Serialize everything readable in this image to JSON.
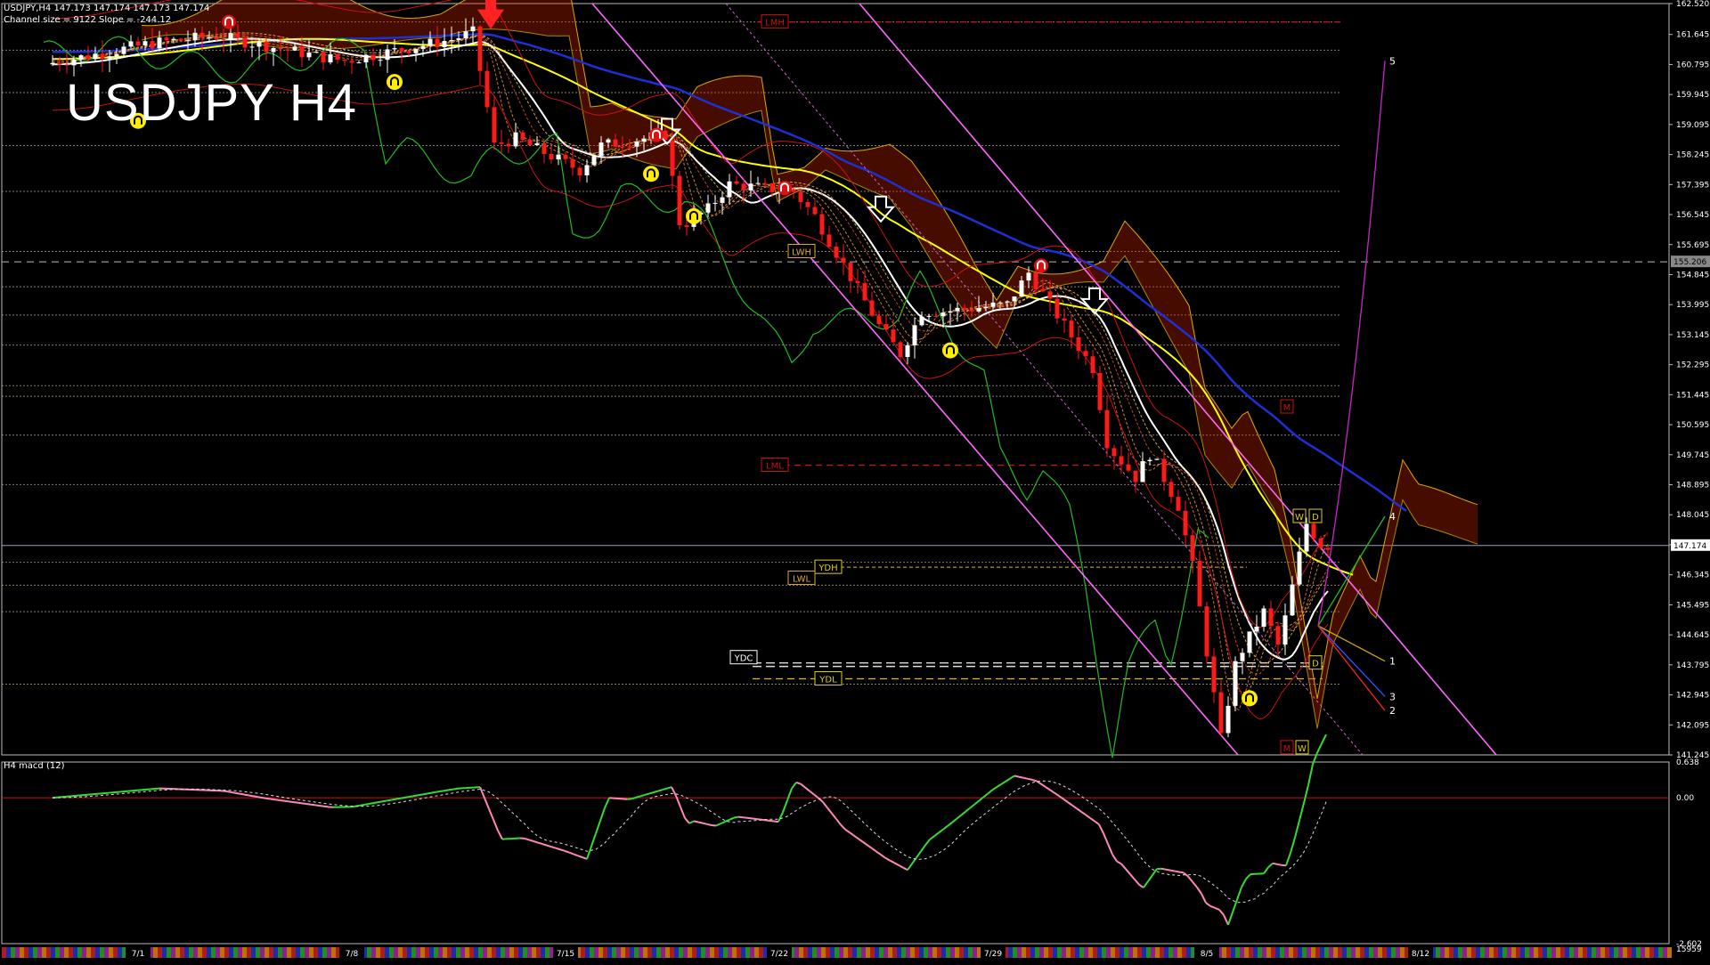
{
  "header": {
    "symbol_line": "USDJPY,H4  147.173 147.174 147.173 147.174",
    "channel_line": "Channel size = 9122 Slope = -244.12",
    "watermark": "USDJPY H4",
    "macd_label": "H4 macd (12)"
  },
  "colors": {
    "background": "#000000",
    "bull_candle": "#ffffff",
    "bear_candle": "#ff1a1a",
    "ma_fast": "#ffffff",
    "ma_mid": "#ffff00",
    "ma_slow": "#1f2fd6",
    "channel": "#ff66ff",
    "ichimoku_cloud": "#cc2200",
    "chikou": "#22bb22",
    "macd_up": "#33dd33",
    "macd_down": "#ff88bb"
  },
  "chart_data": {
    "type": "candlestick",
    "symbol": "USDJPY",
    "timeframe": "H4",
    "ylim": [
      141.245,
      162.52
    ],
    "y_ticks": [
      "162.520",
      "161.645",
      "160.795",
      "159.945",
      "159.095",
      "158.245",
      "157.395",
      "156.545",
      "155.695",
      "154.845",
      "153.995",
      "153.145",
      "152.295",
      "151.445",
      "150.595",
      "149.745",
      "148.895",
      "148.045",
      "147.195",
      "146.345",
      "145.495",
      "144.645",
      "143.795",
      "142.945",
      "142.095",
      "141.245"
    ],
    "current_price": "147.174",
    "marker_price": "155.206",
    "x_tick_labels": [
      "7/1",
      "7/8",
      "7/15",
      "7/22",
      "7/29",
      "8/5",
      "8/12"
    ],
    "close_path": [
      {
        "date": "6/27",
        "close": 160.8
      },
      {
        "date": "7/1",
        "close": 161.4
      },
      {
        "date": "7/3",
        "close": 161.6
      },
      {
        "date": "7/5",
        "close": 161.0
      },
      {
        "date": "7/8",
        "close": 160.9
      },
      {
        "date": "7/10",
        "close": 161.5
      },
      {
        "date": "7/11",
        "close": 161.7
      },
      {
        "date": "7/11",
        "close": 158.5
      },
      {
        "date": "7/12",
        "close": 158.7
      },
      {
        "date": "7/15",
        "close": 157.8
      },
      {
        "date": "7/16",
        "close": 158.5
      },
      {
        "date": "7/17",
        "close": 158.8
      },
      {
        "date": "7/17",
        "close": 156.2
      },
      {
        "date": "7/18",
        "close": 156.7
      },
      {
        "date": "7/19",
        "close": 157.4
      },
      {
        "date": "7/22",
        "close": 157.2
      },
      {
        "date": "7/23",
        "close": 156.5
      },
      {
        "date": "7/24",
        "close": 153.4
      },
      {
        "date": "7/25",
        "close": 152.6
      },
      {
        "date": "7/25",
        "close": 153.8
      },
      {
        "date": "7/26",
        "close": 153.8
      },
      {
        "date": "7/29",
        "close": 154.0
      },
      {
        "date": "7/30",
        "close": 154.9
      },
      {
        "date": "7/31",
        "close": 152.2
      },
      {
        "date": "7/31",
        "close": 150.0
      },
      {
        "date": "8/1",
        "close": 149.1
      },
      {
        "date": "8/1",
        "close": 149.8
      },
      {
        "date": "8/2",
        "close": 148.3
      },
      {
        "date": "8/2",
        "close": 146.5
      },
      {
        "date": "8/5",
        "close": 141.7
      },
      {
        "date": "8/5",
        "close": 143.9
      },
      {
        "date": "8/6",
        "close": 145.3
      },
      {
        "date": "8/6",
        "close": 144.3
      },
      {
        "date": "8/7",
        "close": 147.8
      },
      {
        "date": "8/7",
        "close": 147.17
      }
    ],
    "level_labels": [
      {
        "text": "LMH",
        "price": 162.0
      },
      {
        "text": "LWH",
        "price": 155.5
      },
      {
        "text": "LML",
        "price": 149.45
      },
      {
        "text": "YDH",
        "price": 146.56
      },
      {
        "text": "LWL",
        "price": 146.25
      },
      {
        "text": "YDC",
        "price": 144.0
      },
      {
        "text": "YDL",
        "price": 143.4
      },
      {
        "text": "W",
        "price": 148.0
      },
      {
        "text": "D",
        "price": 148.0
      },
      {
        "text": "D",
        "price": 143.85
      },
      {
        "text": "M",
        "price": 151.1
      },
      {
        "text": "M",
        "price": 141.45
      },
      {
        "text": "W",
        "price": 141.45
      }
    ],
    "projection_labels": [
      "5",
      "4",
      "1",
      "3",
      "2"
    ],
    "macd": {
      "name": "macd (12)",
      "ylim": [
        -2.602,
        0.638
      ],
      "y_ticks": [
        "0.638",
        "0.00",
        "-2.602"
      ],
      "bottom_value": "15959"
    }
  }
}
